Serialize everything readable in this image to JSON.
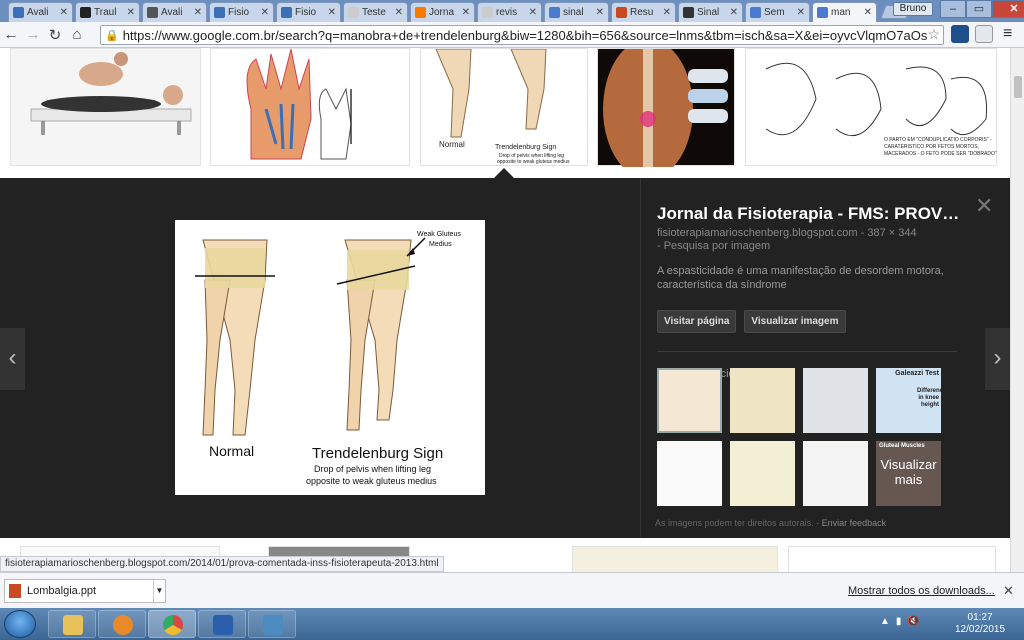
{
  "browser": {
    "user_name": "Bruno",
    "tabs": [
      {
        "label": "Avali",
        "favicon_color": "#3b6fb6"
      },
      {
        "label": "Traul",
        "favicon_color": "#222222"
      },
      {
        "label": "Avali",
        "favicon_color": "#555555"
      },
      {
        "label": "Fisio",
        "favicon_color": "#3b6fb6"
      },
      {
        "label": "Fisio",
        "favicon_color": "#3b6fb6"
      },
      {
        "label": "Teste",
        "favicon_color": "#cccccc"
      },
      {
        "label": "Jorna",
        "favicon_color": "#f57c00"
      },
      {
        "label": "revis",
        "favicon_color": "#cccccc"
      },
      {
        "label": "sinal",
        "favicon_color": "#4a7bd0"
      },
      {
        "label": "Resu",
        "favicon_color": "#c94a22"
      },
      {
        "label": "Sinal",
        "favicon_color": "#333333"
      },
      {
        "label": "Sem",
        "favicon_color": "#4a7bd0"
      },
      {
        "label": "man",
        "favicon_color": "#4a7bd0"
      }
    ],
    "url": "https://www.google.com.br/search?q=manobra+de+trendelenburg&biw=1280&bih=656&source=lnms&tbm=isch&sa=X&ei=oyvcVlqmO7aOs",
    "status_url": "fisioterapiamarioschenberg.blogspot.com/2014/01/prova-comentada-inss-fisioterapeuta-2013.html"
  },
  "top_thumbs": [
    {
      "caption": ""
    },
    {
      "caption": ""
    },
    {
      "caption": "Normal  Trendelenburg Sign  Drop of pelvis when lifting leg opposite to weak gluteus medius"
    },
    {
      "caption": ""
    },
    {
      "caption": "O PARTO EM \"CONDUPLICATIO CORPORIS\" - CARATERISTICO POR FETOS MORTOS, MACERADOS - O FETO PODE SER \"DOBRADO\""
    }
  ],
  "main_image": {
    "label_weak": "Weak Gluteus",
    "label_weak2": "Medius",
    "label_normal": "Normal",
    "label_sign": "Trendelenburg Sign",
    "label_drop1": "Drop of pelvis when lifting leg",
    "label_drop2": "opposite to weak gluteus medius"
  },
  "detail": {
    "title": "Jornal da Fisioterapia - FMS: PROV…",
    "source": "fisioterapiamarioschenberg.blogspot.com",
    "size": "387 × 344",
    "search_by_image": "-  Pesquisa por imagem",
    "description": "A espasticidade é uma manifestação de desordem motora, característica da síndrome",
    "visit_button": "Visitar página",
    "view_button": "Visualizar imagem",
    "related_label": "Imagens relacionadas:",
    "more_label": "Visualizar mais",
    "rights": "As imagens podem ter direitos autorais.",
    "feedback": "Enviar feedback",
    "close_icon": "close-icon",
    "related_texts": [
      "Galeazzi Test",
      "Difference in knee height",
      "Gluteal Muscles"
    ]
  },
  "download": {
    "file": "Lombalgia.ppt",
    "show_all": "Mostrar todos os downloads..."
  },
  "taskbar": {
    "time": "01:27",
    "date": "12/02/2015"
  },
  "colors": {
    "panel_bg": "#222222",
    "chrome_tab_strip": "#6d8fbf",
    "taskbar": "#3a6593"
  }
}
